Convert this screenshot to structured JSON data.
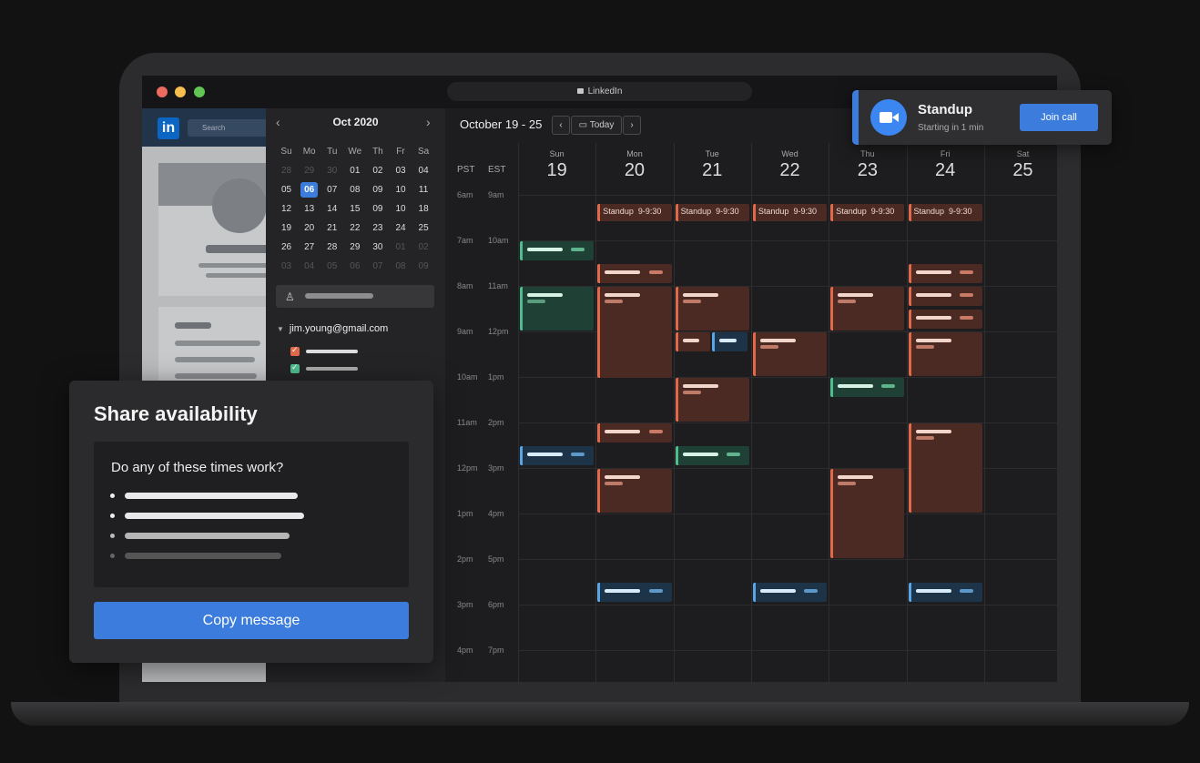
{
  "browser": {
    "url": "LinkedIn"
  },
  "linkedin": {
    "logo": "in",
    "search_placeholder": "Search"
  },
  "mini_cal": {
    "month": "Oct 2020",
    "weekdays": [
      "Su",
      "Mo",
      "Tu",
      "We",
      "Th",
      "Fr",
      "Sa"
    ],
    "weeks": [
      [
        "28",
        "29",
        "30",
        "01",
        "02",
        "03",
        "04"
      ],
      [
        "05",
        "06",
        "07",
        "08",
        "09",
        "10",
        "11"
      ],
      [
        "12",
        "13",
        "14",
        "15",
        "09",
        "10",
        "18"
      ],
      [
        "19",
        "20",
        "21",
        "22",
        "23",
        "24",
        "25"
      ],
      [
        "26",
        "27",
        "28",
        "29",
        "30",
        "01",
        "02"
      ],
      [
        "03",
        "04",
        "05",
        "06",
        "07",
        "08",
        "09"
      ]
    ],
    "selected": "06"
  },
  "account": {
    "email": "jim.young@gmail.com"
  },
  "calendar": {
    "range": "October 19 - 25",
    "today_label": "Today",
    "timezones": [
      "PST",
      "EST"
    ],
    "days": [
      {
        "name": "Sun",
        "date": "19"
      },
      {
        "name": "Mon",
        "date": "20"
      },
      {
        "name": "Tue",
        "date": "21"
      },
      {
        "name": "Wed",
        "date": "22"
      },
      {
        "name": "Thu",
        "date": "23"
      },
      {
        "name": "Fri",
        "date": "24"
      },
      {
        "name": "Sat",
        "date": "25"
      }
    ],
    "times_pst": [
      "6am",
      "7am",
      "8am",
      "9am",
      "10am",
      "11am",
      "12pm",
      "1pm",
      "2pm",
      "3pm",
      "4pm"
    ],
    "times_est": [
      "9am",
      "10am",
      "11am",
      "12pm",
      "1pm",
      "2pm",
      "3pm",
      "4pm",
      "5pm",
      "6pm",
      "7pm"
    ],
    "standup": {
      "title": "Standup",
      "time": "9-9:30"
    }
  },
  "notification": {
    "title": "Standup",
    "subtitle": "Starting in 1 min",
    "button": "Join call"
  },
  "share": {
    "title": "Share availability",
    "question": "Do any of these times work?",
    "button": "Copy message"
  },
  "colors": {
    "accent": "#3b7cdc",
    "event_orange": "#e0694a",
    "event_green": "#4fbd8e",
    "event_blue": "#5aa5e6"
  }
}
